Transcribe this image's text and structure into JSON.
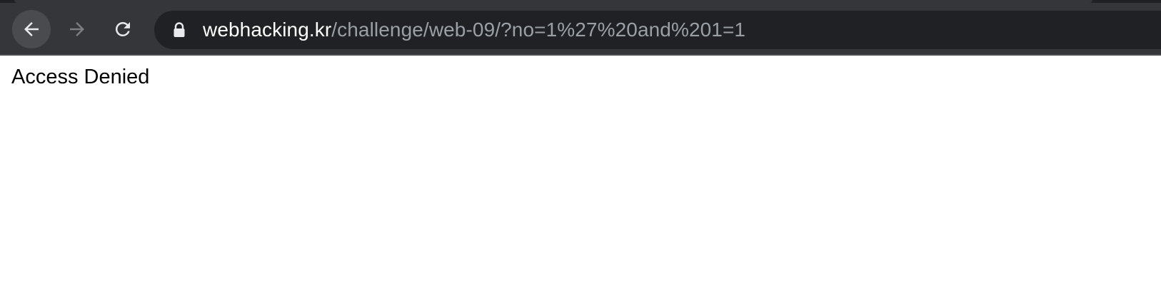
{
  "browser": {
    "url_host": "webhacking.kr",
    "url_path": "/challenge/web-09/?no=1%27%20and%201=1",
    "icons": {
      "back": "back-arrow-icon",
      "forward": "forward-arrow-icon",
      "reload": "reload-icon",
      "lock": "lock-icon"
    },
    "colors": {
      "chrome": "#35363a",
      "omnibox": "#202124",
      "host_text": "#ffffff",
      "path_text": "#9aa0a6"
    }
  },
  "page": {
    "message": "Access Denied"
  }
}
